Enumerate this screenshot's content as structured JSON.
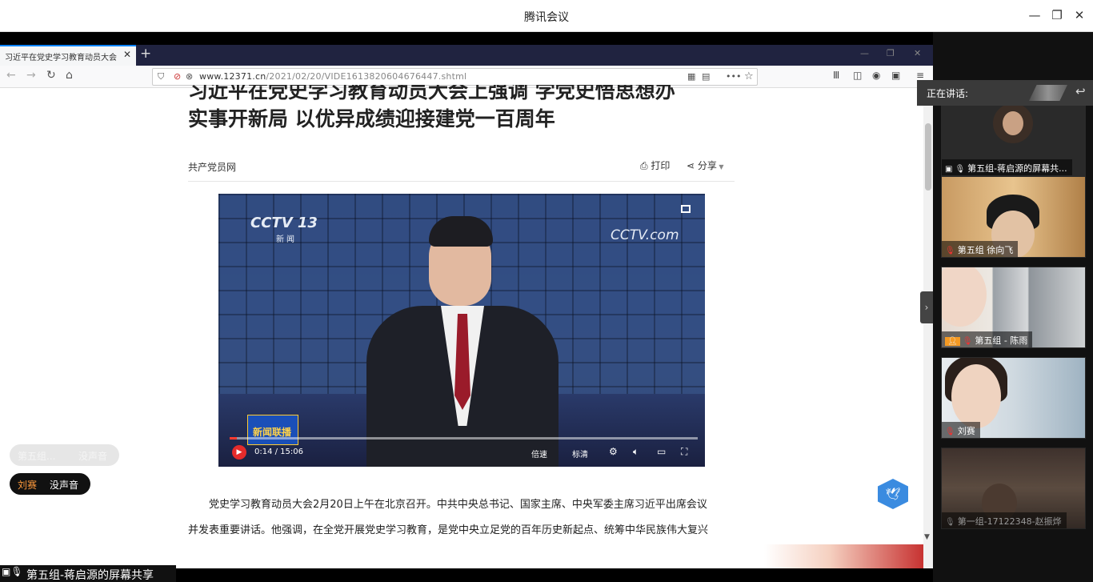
{
  "meeting": {
    "title": "腾讯会议",
    "min_glyph": "—",
    "max_glyph": "❐",
    "close_glyph": "✕"
  },
  "browser": {
    "tab_title": "习近平在党史学习教育动员大会上强调 学党史悟思想办实事开新局",
    "tab_close": "✕",
    "new_tab": "+",
    "win_min": "—",
    "win_max": "❐",
    "win_close": "✕",
    "back": "←",
    "forward": "→",
    "reload": "↻",
    "home": "⌂",
    "url_host": "www.12371.cn",
    "url_path": "/2021/02/20/VIDE1613820604676447.shtml",
    "more_glyph": "•••",
    "star_glyph": "☆"
  },
  "article": {
    "headline_line1": "习近平在党史学习教育动员大会上强调 学党史悟思想办",
    "headline_line2": "实事开新局 以优异成绩迎接建党一百周年",
    "source": "共产党员网",
    "print_label": "打印",
    "share_label": "分享",
    "paragraph_line1": "党史学习教育动员大会2月20日上午在北京召开。中共中央总书记、国家主席、中央军委主席习近平出席会议",
    "paragraph_line2": "并发表重要讲话。他强调，在全党开展党史学习教育，是党中央立足党的百年历史新起点、统筹中华民族伟大复兴"
  },
  "video": {
    "channel_logo": "CCTV 13",
    "channel_sub": "新闻",
    "watermark": "CCTV.com",
    "program_logo": "新闻联播",
    "time": "0:14 / 15:06",
    "progress": 0.015,
    "speed_label": "倍速",
    "quality_label": "标清"
  },
  "overlays": {
    "dim_pill_name": "第五组...",
    "dim_pill_state": "没声音",
    "speaker_name": "刘赛",
    "speaker_state": "没声音",
    "share_caption": "第五组-蒋启源的屏幕共享"
  },
  "panel": {
    "speaking_label": "正在讲话:",
    "tiles": [
      {
        "label": "第五组-蒋启源的屏幕共..."
      },
      {
        "label": "第五组 徐向飞"
      },
      {
        "label": "第五组 - 陈雨"
      },
      {
        "label": "刘赛"
      },
      {
        "label": "第一组-17122348-赵振烨"
      }
    ]
  }
}
